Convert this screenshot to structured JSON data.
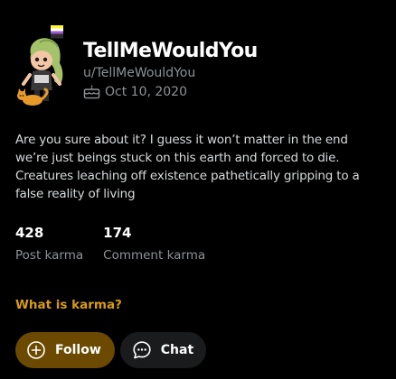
{
  "profile": {
    "display_name": "TellMeWouldYou",
    "username": "u/TellMeWouldYou",
    "cake_day": "Oct 10, 2020",
    "bio": "Are you sure about it? I guess it won’t matter in the end we’re just beings stuck on this earth and forced to die. Creatures leaching off existence pathetically gripping to a false reality of living"
  },
  "stats": [
    {
      "value": "428",
      "label": "Post karma"
    },
    {
      "value": "174",
      "label": "Comment karma"
    }
  ],
  "links": {
    "karma_help": "What is karma?"
  },
  "actions": {
    "follow_label": "Follow",
    "chat_label": "Chat"
  },
  "icons": {
    "avatar": "snoo-avatar",
    "cake": "cake-icon",
    "follow": "plus-circle-icon",
    "chat": "chat-bubble-icon"
  },
  "colors": {
    "background": "#000000",
    "text_primary": "#ffffff",
    "text_secondary": "#8c9296",
    "accent_link": "#d99c12",
    "follow_button": "#6b4a00",
    "chat_button": "#1a1b1d"
  }
}
